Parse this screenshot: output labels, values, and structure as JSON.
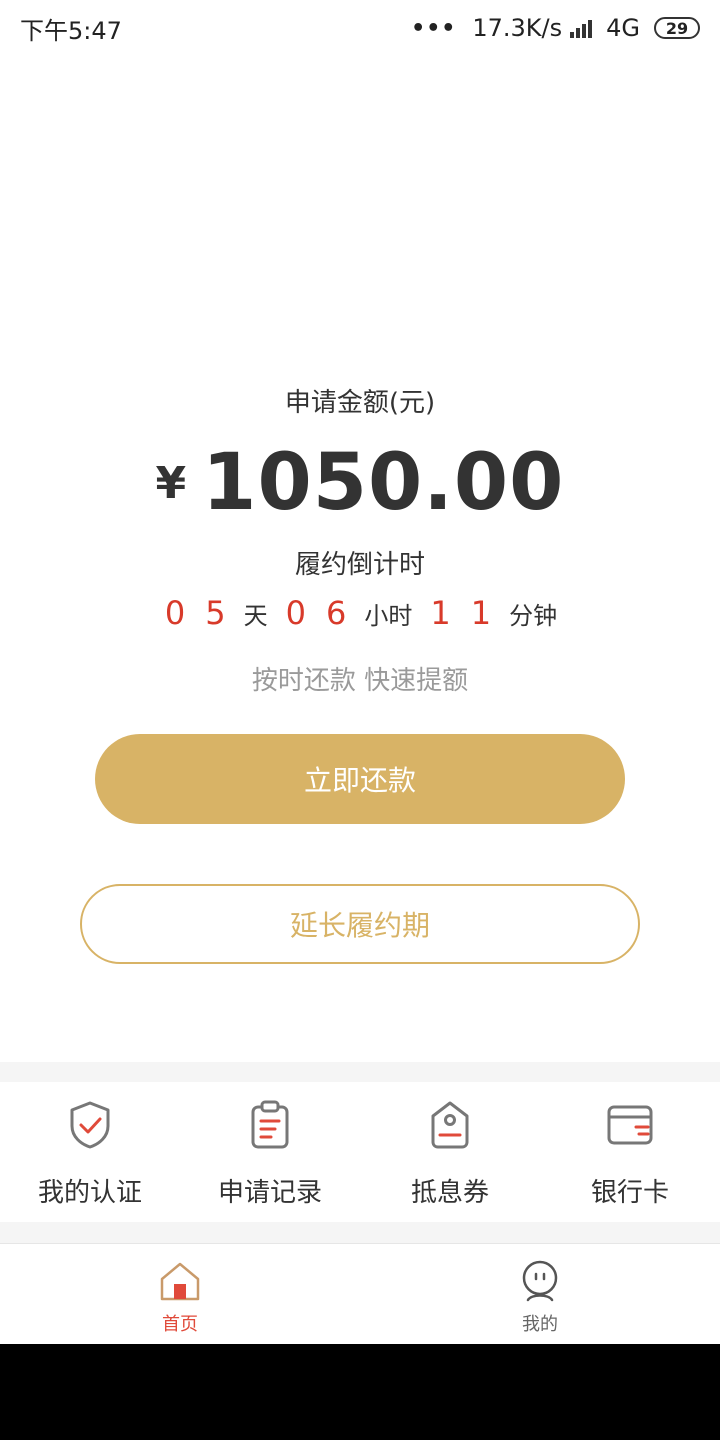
{
  "status_bar": {
    "time": "下午5:47",
    "dots": "•••",
    "network_speed": "17.3K/s",
    "network_type": "4G",
    "battery": "29"
  },
  "main": {
    "apply_label": "申请金额(元)",
    "currency_symbol": "¥",
    "amount": "1050.00",
    "countdown_label": "履约倒计时",
    "countdown": {
      "days_d1": "0",
      "days_d2": "5",
      "days_unit": "天",
      "hours_d1": "0",
      "hours_d2": "6",
      "hours_unit": "小时",
      "minutes_d1": "1",
      "minutes_d2": "1",
      "minutes_unit": "分钟"
    },
    "slogan": "按时还款 快速提额",
    "repay_button": "立即还款",
    "extend_button": "延长履约期"
  },
  "quick_menu": [
    {
      "label": "我的认证",
      "icon": "shield-check-icon"
    },
    {
      "label": "申请记录",
      "icon": "clipboard-icon"
    },
    {
      "label": "抵息券",
      "icon": "coupon-tag-icon"
    },
    {
      "label": "银行卡",
      "icon": "bank-card-icon"
    }
  ],
  "tab_bar": [
    {
      "label": "首页",
      "icon": "home-icon",
      "active": true
    },
    {
      "label": "我的",
      "icon": "profile-face-icon",
      "active": false
    }
  ],
  "colors": {
    "accent_gold": "#d8b366",
    "countdown_red": "#d83a2a",
    "tab_active_red": "#e04a3a"
  }
}
